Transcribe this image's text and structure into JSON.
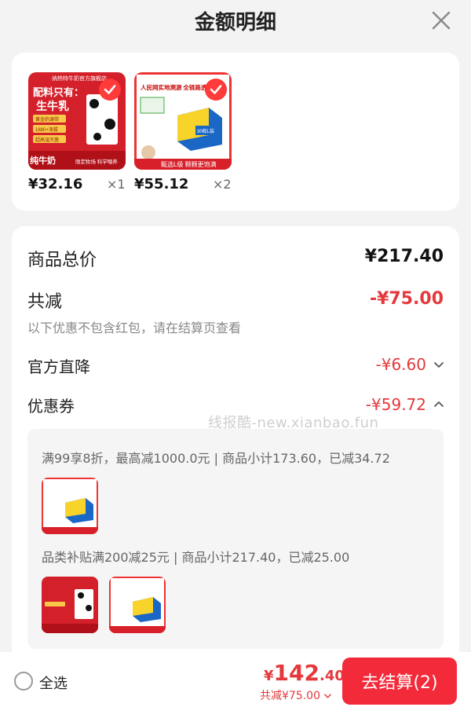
{
  "header": {
    "title": "金额明细",
    "close_icon": "close-icon"
  },
  "products": [
    {
      "price": "¥32.16",
      "qty": "×1",
      "thumb_text": {
        "store": "纳热特牛奶官方旗舰店",
        "headline": "配料只有：",
        "headline2": "生牛乳",
        "tag1": "黄金奶源带",
        "tag2": "1880+海拔",
        "tag3": "超高温灭菌",
        "bottom": "纯牛奶",
        "bottom2": "限定牧场 科学喂养"
      }
    },
    {
      "price": "¥55.12",
      "qty": "×2",
      "thumb_text": {
        "headline": "人民网实地溯源 全链路透明品牌",
        "box": "30枚L装",
        "bottom": "甄选L级 颗颗更饱满"
      }
    }
  ],
  "summary": {
    "total_label": "商品总价",
    "total_value": "¥217.40",
    "discount_label": "共减",
    "discount_value": "-¥75.00",
    "note": "以下优惠不包含红包，请在结算页查看",
    "official_label": "官方直降",
    "official_value": "-¥6.60",
    "coupon_label": "优惠券",
    "coupon_value": "-¥59.72"
  },
  "watermark": "线报酷-new.xianbao.fun",
  "coupons": [
    {
      "text": "满99享8折，最高减1000.0元 | 商品小计173.60，已减34.72"
    },
    {
      "text": "品类补贴满200减25元 | 商品小计217.40，已减25.00"
    }
  ],
  "bottom": {
    "select_all": "全选",
    "currency": "¥",
    "price_int": "142",
    "price_dec": ".40",
    "discount": "共减¥75.00",
    "checkout": "去结算(2)"
  },
  "colors": {
    "accent": "#e4393c",
    "button": "#f32a3a"
  }
}
